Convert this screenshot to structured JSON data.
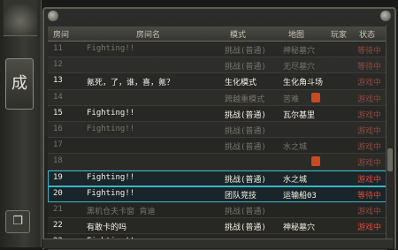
{
  "sidebar": {
    "main_button_label": "成",
    "bottom_icon_label": "❐"
  },
  "header": {
    "col_no": "房间",
    "col_name": "房间名",
    "col_mode": "模式",
    "col_map": "地图",
    "col_players": "玩家",
    "col_status": "状态"
  },
  "rows": [
    {
      "no": "11",
      "name": "Fighting!!",
      "mode": "挑战(普通)",
      "map": "神秘墓穴",
      "players": "",
      "status": "等待中",
      "style": "dim",
      "status_color": "dimred"
    },
    {
      "no": "12",
      "name": "",
      "mode": "挑战(普通)",
      "map": "无尽墓穴",
      "players": "",
      "status": "等待中",
      "style": "dim",
      "status_color": "dimred"
    },
    {
      "no": "13",
      "name": "氪死，了，谁，喜，氪？",
      "mode": "生化模式",
      "map": "生化角斗场",
      "players": "",
      "status": "游戏中",
      "style": "bright",
      "status_color": "dimred"
    },
    {
      "no": "14",
      "name": "",
      "mode": "跨越重模式",
      "map": "苦难",
      "players": "",
      "status": "游戏中",
      "style": "dim",
      "status_color": "dimred",
      "lock": true
    },
    {
      "no": "15",
      "name": "Fighting!!",
      "mode": "挑战(普通)",
      "map": "瓦尔基里",
      "players": "",
      "status": "游戏中",
      "style": "bright",
      "status_color": "dimred"
    },
    {
      "no": "16",
      "name": "Fighting!!",
      "mode": "挑战(普通)",
      "map": "",
      "players": "",
      "status": "游戏中",
      "style": "dim",
      "status_color": "dimred"
    },
    {
      "no": "17",
      "name": "",
      "mode": "挑战(普通)",
      "map": "水之城",
      "players": "",
      "status": "游戏中",
      "style": "dim",
      "status_color": "dimred"
    },
    {
      "no": "18",
      "name": "",
      "mode": "",
      "map": "",
      "players": "",
      "status": "游戏中",
      "style": "dim",
      "status_color": "dimred",
      "lock": true
    },
    {
      "no": "19",
      "name": "Fighting!!",
      "mode": "挑战(普通)",
      "map": "水之城",
      "players": "",
      "status": "游戏中",
      "style": "bright",
      "status_color": "red",
      "selected": true
    },
    {
      "no": "20",
      "name": "Fighting!!",
      "mode": "团队竞技",
      "map": "运输船03",
      "players": "",
      "status": "等待中",
      "style": "bright",
      "status_color": "red",
      "selected": true
    },
    {
      "no": "21",
      "name": "黑机仓夫卡窗 肯迪",
      "mode": "挑战(普通)",
      "map": "",
      "players": "",
      "status": "游戏中",
      "style": "dim",
      "status_color": "dimred"
    },
    {
      "no": "22",
      "name": "有敢卡的吗",
      "mode": "挑战(普通)",
      "map": "神秘墓穴",
      "players": "",
      "status": "游戏中",
      "style": "bright",
      "status_color": "red"
    },
    {
      "no": "23",
      "name": "Fighting!!",
      "mode": "挑战(普通)",
      "map": "神秘墓穴",
      "players": "",
      "status": "游戏中",
      "style": "bright",
      "status_color": "red"
    }
  ]
}
